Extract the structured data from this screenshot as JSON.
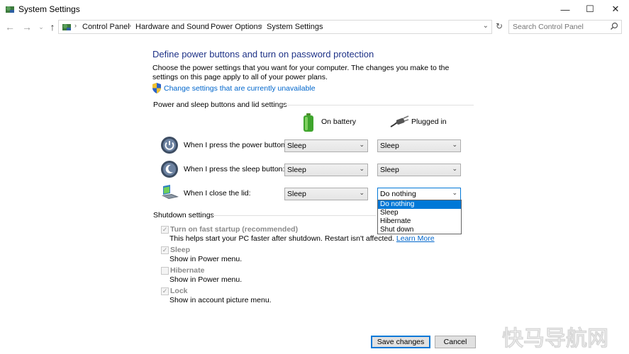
{
  "window": {
    "title": "System Settings",
    "controls": {
      "minimize": "—",
      "maximize": "☐",
      "close": "✕"
    }
  },
  "nav": {
    "back": "←",
    "forward": "→",
    "recent": "⌄",
    "up": "↑",
    "breadcrumbs": [
      "Control Panel",
      "Hardware and Sound",
      "Power Options",
      "System Settings"
    ],
    "refresh": "↻",
    "search_placeholder": "Search Control Panel"
  },
  "main": {
    "heading": "Define power buttons and turn on password protection",
    "description": "Choose the power settings that you want for your computer. The changes you make to the settings on this page apply to all of your power plans.",
    "change_link": "Change settings that are currently unavailable",
    "power_section_title": "Power and sleep buttons and lid settings",
    "columns": {
      "battery": "On battery",
      "plugged": "Plugged in"
    },
    "rows": [
      {
        "label": "When I press the power button:",
        "battery": "Sleep",
        "plugged": "Sleep"
      },
      {
        "label": "When I press the sleep button:",
        "battery": "Sleep",
        "plugged": "Sleep"
      },
      {
        "label": "When I close the lid:",
        "battery": "Sleep",
        "plugged": "Do nothing"
      }
    ],
    "dropdown_options": [
      "Do nothing",
      "Sleep",
      "Hibernate",
      "Shut down"
    ],
    "dropdown_selected": "Do nothing",
    "shutdown_section_title": "Shutdown settings",
    "shutdown_items": [
      {
        "label": "Turn on fast startup (recommended)",
        "checked": true,
        "sub": "This helps start your PC faster after shutdown. Restart isn't affected.",
        "link": "Learn More"
      },
      {
        "label": "Sleep",
        "checked": true,
        "sub": "Show in Power menu."
      },
      {
        "label": "Hibernate",
        "checked": false,
        "sub": "Show in Power menu."
      },
      {
        "label": "Lock",
        "checked": true,
        "sub": "Show in account picture menu."
      }
    ]
  },
  "footer": {
    "save": "Save changes",
    "cancel": "Cancel"
  },
  "watermark": "快马导航网",
  "colors": {
    "heading": "#1e3287",
    "link": "#0066cc",
    "selection": "#0078d7",
    "watermark": "#ffffff"
  }
}
